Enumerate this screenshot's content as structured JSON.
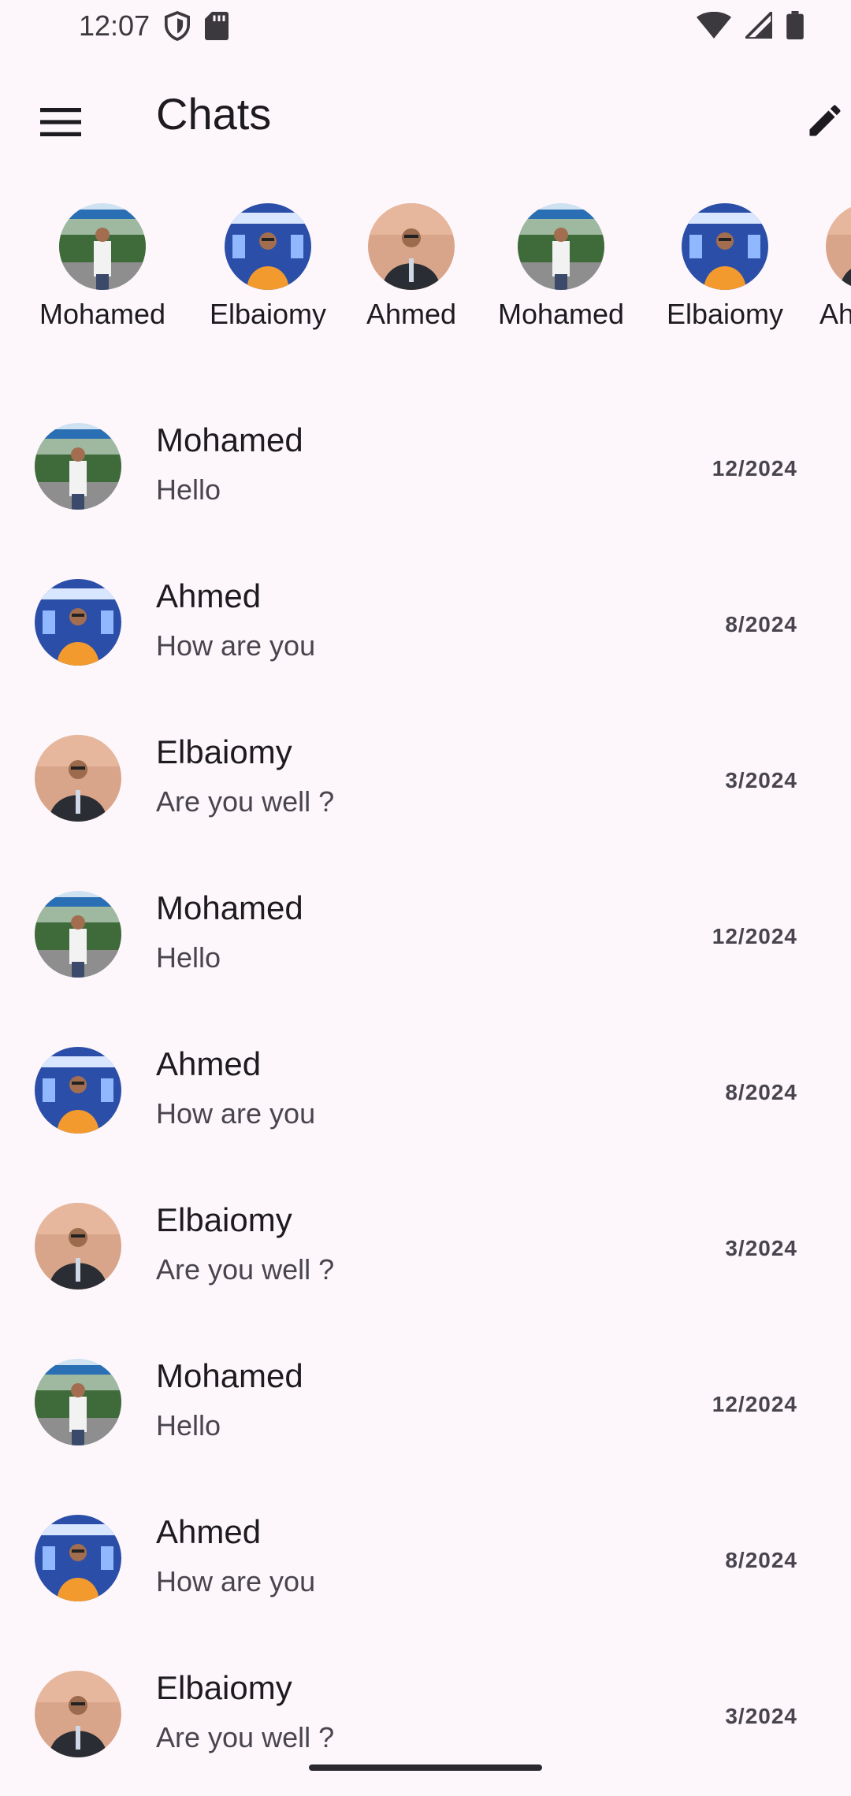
{
  "status_bar": {
    "time": "12:07",
    "left_icons": [
      "shield-icon",
      "sd-card-icon"
    ],
    "right_icons": [
      "wifi-icon",
      "cellular-signal-icon",
      "battery-icon"
    ]
  },
  "app_bar": {
    "title": "Chats",
    "menu_icon": "menu-icon",
    "action_icon": "edit-icon"
  },
  "stories": [
    {
      "name": "Mohamed",
      "photo": "outdoor"
    },
    {
      "name": "Elbaiomy",
      "photo": "banner"
    },
    {
      "name": "Ahmed",
      "photo": "dark"
    },
    {
      "name": "Mohamed",
      "photo": "outdoor"
    },
    {
      "name": "Elbaiomy",
      "photo": "banner"
    },
    {
      "name": "Ah",
      "photo": "dark"
    }
  ],
  "chats": [
    {
      "name": "Mohamed",
      "message": "Hello",
      "date": "12/2024",
      "photo": "outdoor"
    },
    {
      "name": "Ahmed",
      "message": "How are you",
      "date": "8/2024",
      "photo": "banner"
    },
    {
      "name": "Elbaiomy",
      "message": "Are you well ?",
      "date": "3/2024",
      "photo": "dark"
    },
    {
      "name": "Mohamed",
      "message": "Hello",
      "date": "12/2024",
      "photo": "outdoor"
    },
    {
      "name": "Ahmed",
      "message": "How are you",
      "date": "8/2024",
      "photo": "banner"
    },
    {
      "name": "Elbaiomy",
      "message": "Are you well ?",
      "date": "3/2024",
      "photo": "dark"
    },
    {
      "name": "Mohamed",
      "message": "Hello",
      "date": "12/2024",
      "photo": "outdoor"
    },
    {
      "name": "Ahmed",
      "message": "How are you",
      "date": "8/2024",
      "photo": "banner"
    },
    {
      "name": "Elbaiomy",
      "message": "Are you well ?",
      "date": "3/2024",
      "photo": "dark"
    }
  ],
  "colors": {
    "background": "#fdf7fb",
    "text_primary": "#1d1b20",
    "text_secondary": "#49454f"
  }
}
